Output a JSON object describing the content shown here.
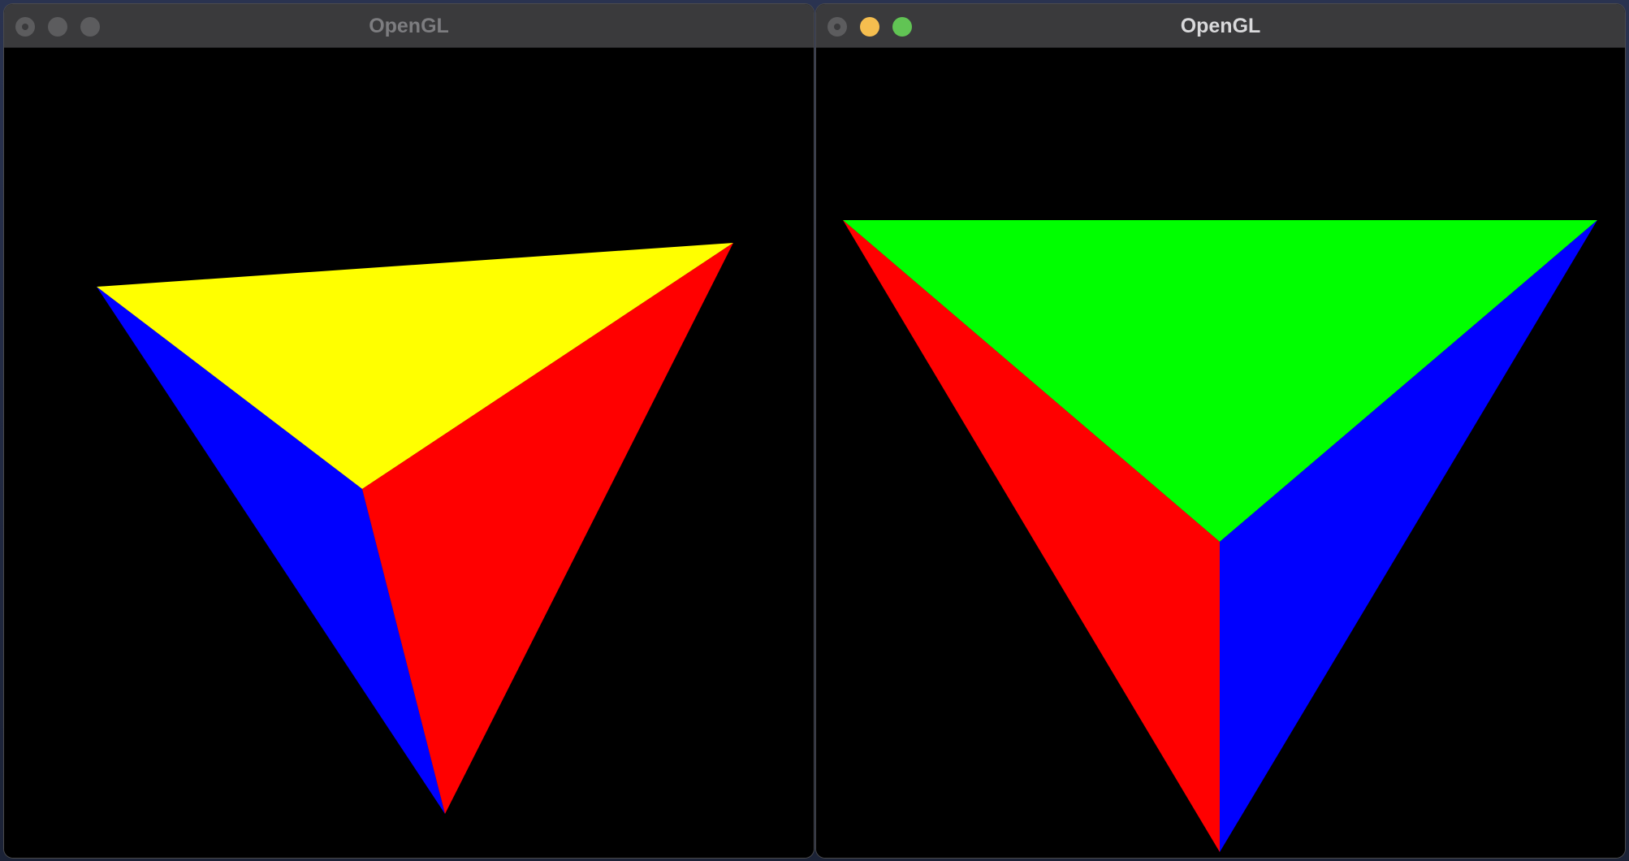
{
  "left_window": {
    "title": "OpenGL",
    "controls": {
      "close": "close-button",
      "minimize": "minimize-button",
      "zoom": "zoom-button"
    },
    "colors": {
      "face_top": "#ffff00",
      "face_left": "#0000ff",
      "face_right": "#ff0000",
      "background": "#000000"
    }
  },
  "right_window": {
    "title": "OpenGL",
    "controls": {
      "close": "close-button",
      "minimize": "minimize-button",
      "zoom": "zoom-button"
    },
    "colors": {
      "face_top": "#00ff00",
      "face_left": "#ff0000",
      "face_right": "#0000ff",
      "background": "#000000"
    }
  }
}
